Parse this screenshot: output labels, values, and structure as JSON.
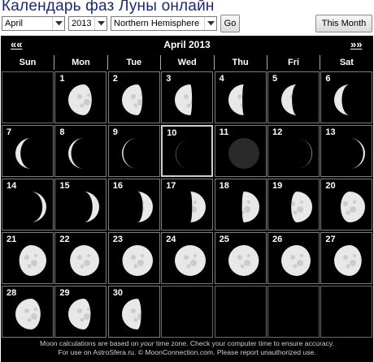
{
  "page": {
    "title": "Календарь фаз Луны онлайн"
  },
  "controls": {
    "month": "April",
    "year": "2013",
    "hemisphere": "Northern Hemisphere",
    "go_label": "Go",
    "this_month_label": "This Month"
  },
  "calendar": {
    "title": "April 2013",
    "prev_label": "««",
    "next_label": "»»",
    "day_names": [
      "Sun",
      "Mon",
      "Tue",
      "Wed",
      "Thu",
      "Fri",
      "Sat"
    ],
    "first_weekday": 1,
    "days_in_month": 30,
    "today": 10,
    "moon_phases": [
      0.664,
      0.698,
      0.732,
      0.766,
      0.8,
      0.834,
      0.868,
      0.902,
      0.936,
      0.97,
      0.0,
      0.038,
      0.077,
      0.116,
      0.154,
      0.193,
      0.231,
      0.27,
      0.309,
      0.348,
      0.386,
      0.425,
      0.464,
      0.503,
      0.541,
      0.575,
      0.609,
      0.643,
      0.677,
      0.711
    ]
  },
  "footer": {
    "line1_prefix": "Moon calculations are based on ",
    "line1_emph": "your",
    "line1_suffix": " time zone. Check your computer time to ensure accuracy.",
    "line2": "For use on AstroSfera.ru. © MoonConnection.com. Please report unauthorized use."
  },
  "colors": {
    "title": "#1b2a6b",
    "calendar_bg": "#000000",
    "moon_light": "#e8e8e8",
    "moon_dark_disc": "#2a2a2a"
  }
}
